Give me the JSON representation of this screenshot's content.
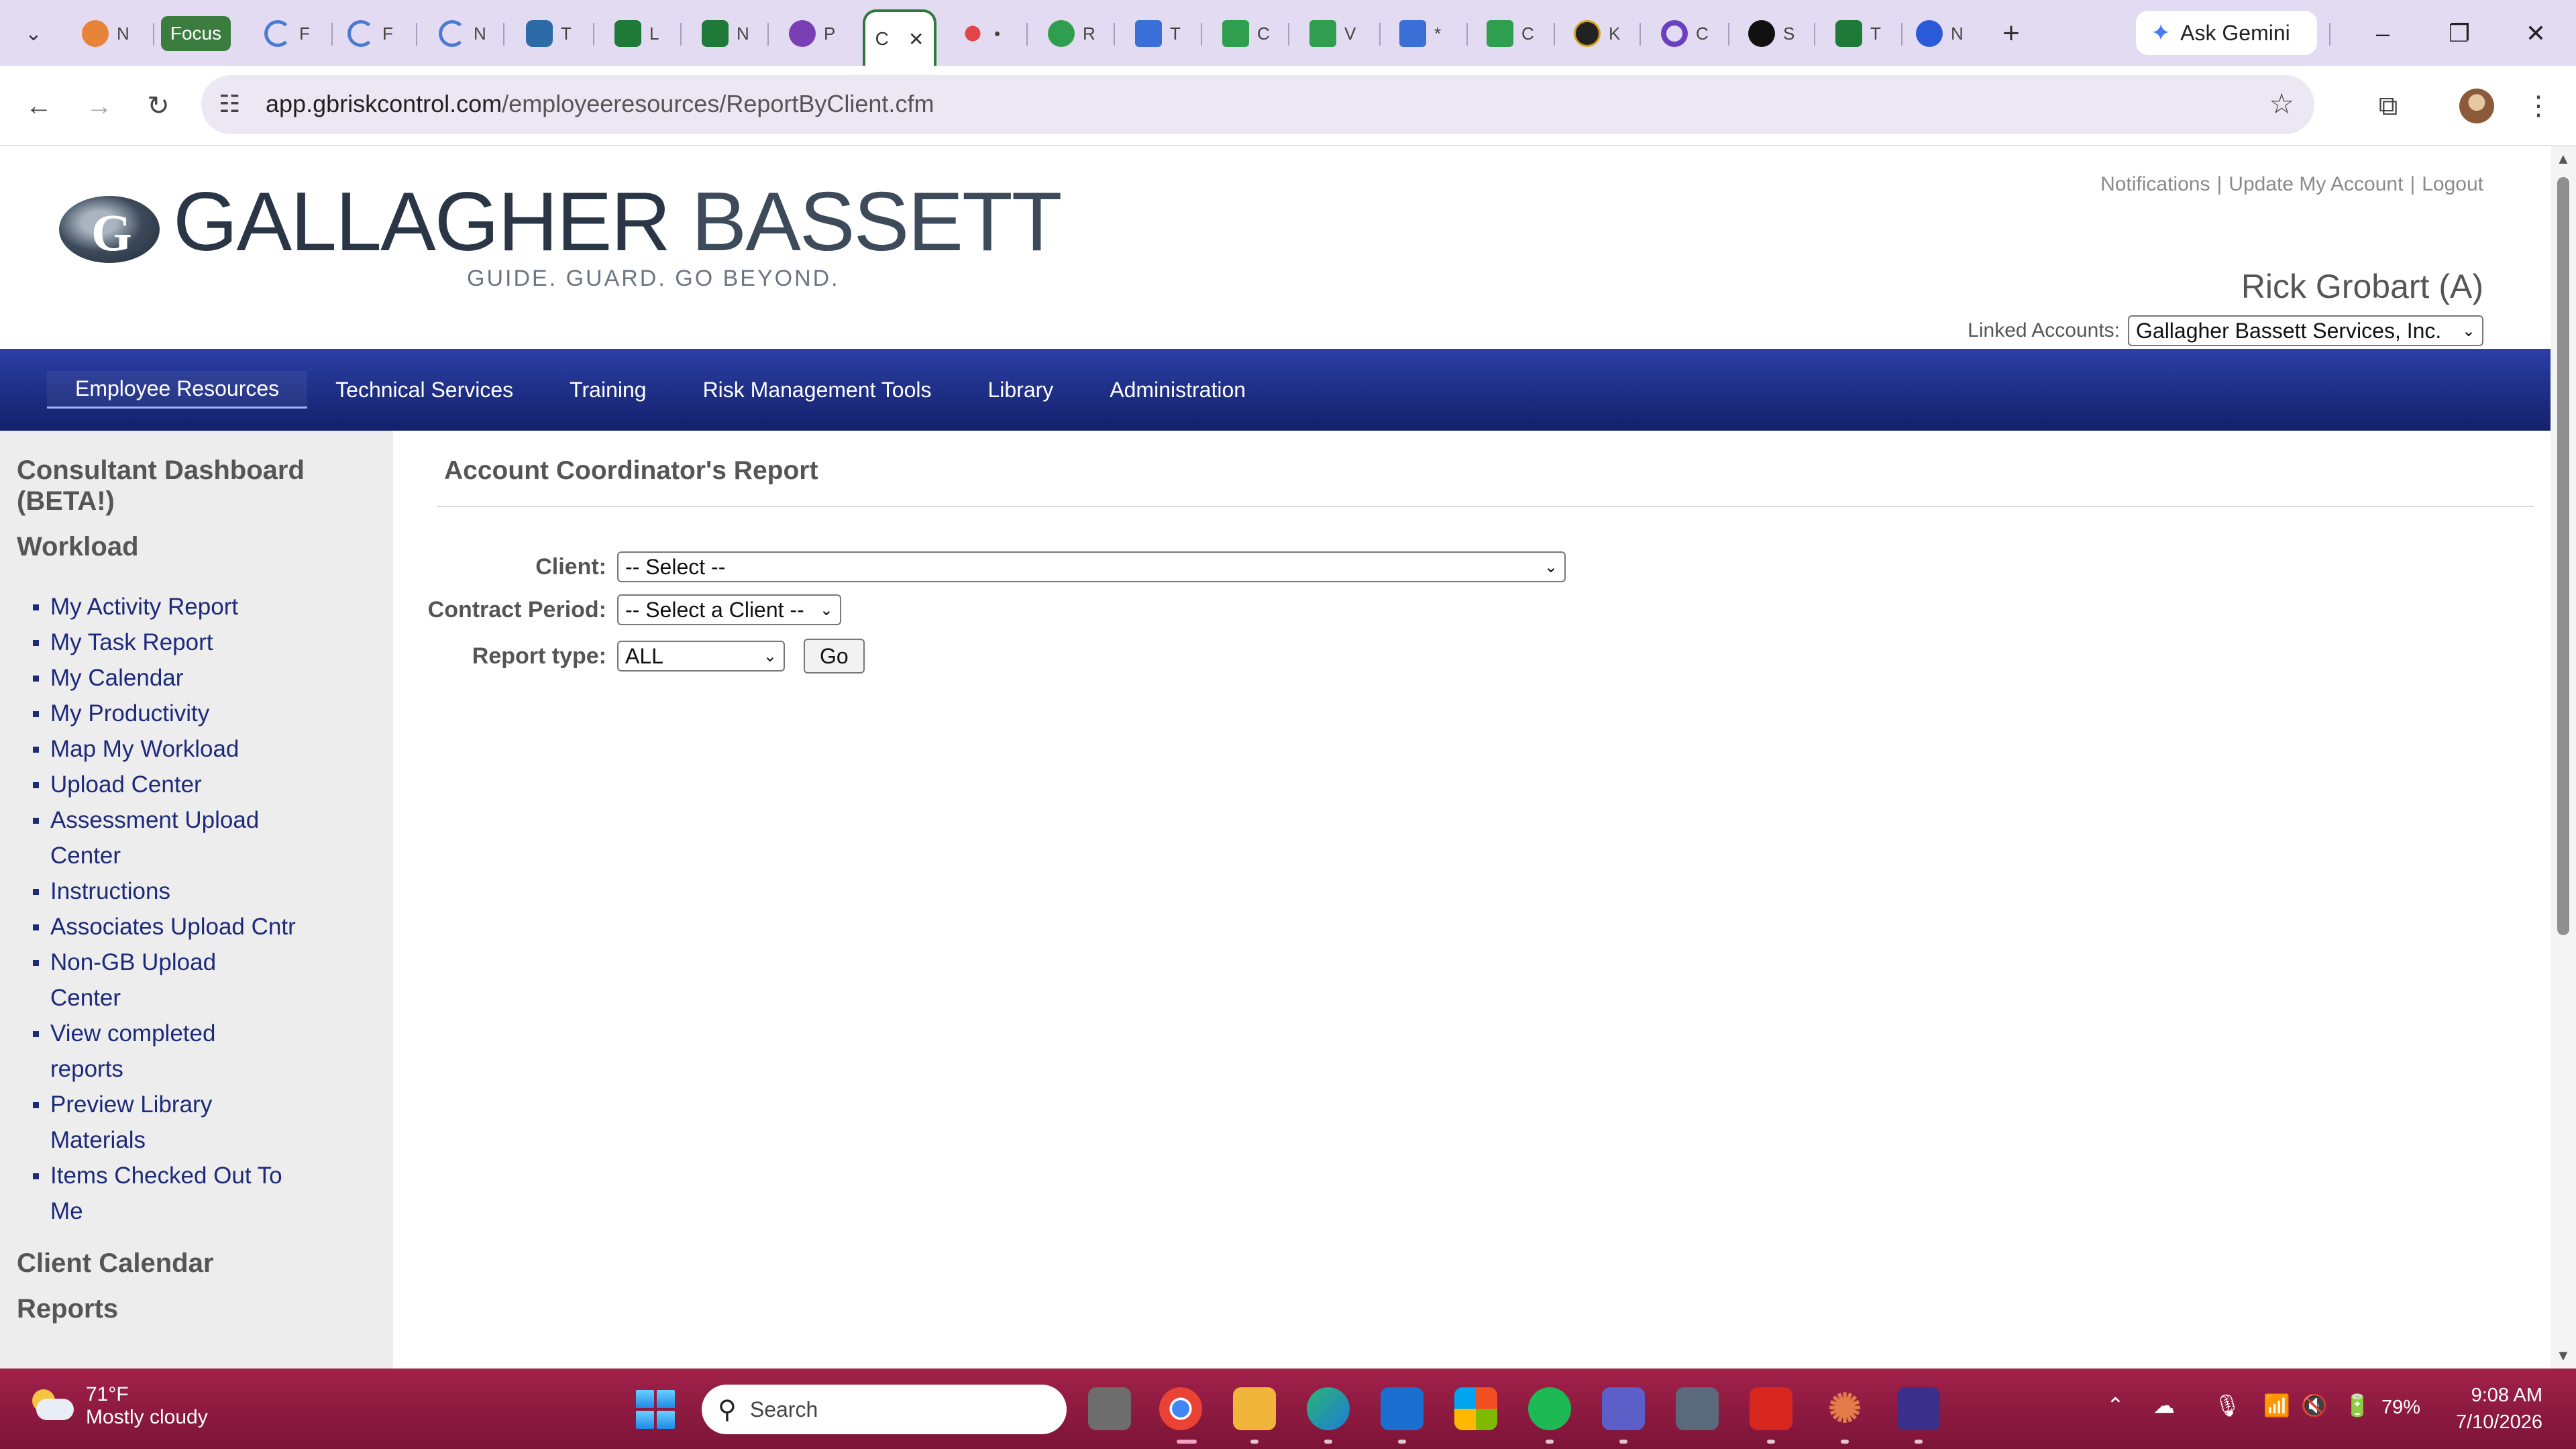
{
  "browser": {
    "focus_label": "Focus",
    "tabs": [
      {
        "letter": "N",
        "color": "#e8833a"
      },
      {
        "letter": "F",
        "color": "#4a7bd0"
      },
      {
        "letter": "F",
        "color": "#4a7bd0"
      },
      {
        "letter": "N",
        "color": "#4a7bd0"
      },
      {
        "letter": "T",
        "color": "#2d6aa8"
      },
      {
        "letter": "L",
        "color": "#1f7a3a"
      },
      {
        "letter": "N",
        "color": "#1f7a3a"
      },
      {
        "letter": "P",
        "color": "#7b3fb5"
      }
    ],
    "active_tab_letter": "C",
    "active_tab_close": "✕",
    "tabs_right": [
      {
        "letter": "•",
        "color": "#e0454a"
      },
      {
        "letter": "R",
        "color": "#2f9e4f"
      },
      {
        "letter": "T",
        "color": "#3a6fd8"
      },
      {
        "letter": "C",
        "color": "#2f9e4f"
      },
      {
        "letter": "V",
        "color": "#2f9e4f"
      },
      {
        "letter": "*",
        "color": "#3a6fd8"
      },
      {
        "letter": "C",
        "color": "#2f9e4f"
      },
      {
        "letter": "K",
        "color": "#222222"
      },
      {
        "letter": "C",
        "color": "#6a3fc0"
      },
      {
        "letter": "S",
        "color": "#111111"
      },
      {
        "letter": "T",
        "color": "#1f7a3a"
      },
      {
        "letter": "N",
        "color": "#2b5ad8"
      }
    ],
    "ask_gemini": "Ask Gemini",
    "url_host": "app.gbriskcontrol.com",
    "url_path": "/employeeresources/ReportByClient.cfm"
  },
  "header": {
    "logo_main_1": "GALLAGHER",
    "logo_main_2": "BASSETT",
    "logo_tagline": "GUIDE. GUARD. GO BEYOND.",
    "links": [
      "Notifications",
      "Update My Account",
      "Logout"
    ],
    "user_name": "Rick Grobart (A)",
    "linked_accounts_label": "Linked Accounts:",
    "linked_account_value": "Gallagher Bassett Services, Inc."
  },
  "nav": {
    "items": [
      "Employee Resources",
      "Technical Services",
      "Training",
      "Risk Management Tools",
      "Library",
      "Administration"
    ]
  },
  "sidebar": {
    "heading_dashboard": "Consultant Dashboard (BETA!)",
    "heading_workload": "Workload",
    "items": [
      "My Activity Report",
      "My Task Report",
      "My Calendar",
      "My Productivity",
      "Map My Workload",
      "Upload Center",
      "Assessment Upload Center",
      "Instructions",
      "Associates Upload Cntr",
      "Non-GB Upload Center",
      "View completed reports",
      "Preview Library Materials",
      "Items Checked Out To Me"
    ],
    "heading_client_calendar": "Client Calendar",
    "heading_reports": "Reports"
  },
  "content": {
    "title": "Account Coordinator's Report",
    "client_label": "Client:",
    "client_value": "-- Select --",
    "contract_label": "Contract Period:",
    "contract_value": "-- Select a Client --",
    "report_label": "Report type:",
    "report_value": "ALL",
    "go_label": "Go"
  },
  "taskbar": {
    "temp": "71°F",
    "weather": "Mostly cloudy",
    "search_placeholder": "Search",
    "battery": "79%",
    "time": "9:08 AM",
    "date": "7/10/2026"
  }
}
